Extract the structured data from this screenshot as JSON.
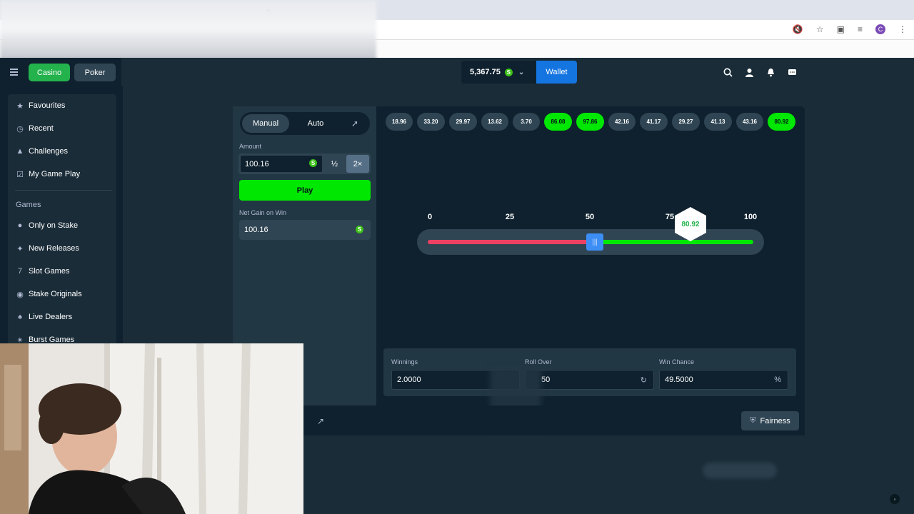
{
  "browser": {
    "new_tab": "+",
    "profile_initial": "C"
  },
  "topbar": {
    "casino_label": "Casino",
    "poker_label": "Poker",
    "balance": "5,367.75",
    "currency_symbol": "S",
    "wallet_label": "Wallet",
    "icons": [
      "search-icon",
      "user-icon",
      "notification-icon",
      "chat-icon"
    ]
  },
  "sidebar": {
    "items": [
      {
        "label": "Favourites",
        "icon": "star-icon"
      },
      {
        "label": "Recent",
        "icon": "clock-icon"
      },
      {
        "label": "Challenges",
        "icon": "challenge-icon"
      },
      {
        "label": "My Game Play",
        "icon": "checkbox-icon"
      }
    ],
    "games_heading": "Games",
    "games": [
      {
        "label": "Only on Stake",
        "icon": "stake-icon"
      },
      {
        "label": "New Releases",
        "icon": "sparkle-icon"
      },
      {
        "label": "Slot Games",
        "icon": "slot-icon"
      },
      {
        "label": "Stake Originals",
        "icon": "flame-icon"
      },
      {
        "label": "Live Dealers",
        "icon": "dealer-icon"
      },
      {
        "label": "Burst Games",
        "icon": "burst-icon"
      }
    ]
  },
  "controls": {
    "manual_label": "Manual",
    "auto_label": "Auto",
    "amount_label": "Amount",
    "amount_value": "100.16",
    "half_label": "½",
    "double_label": "2×",
    "play_label": "Play",
    "net_gain_label": "Net Gain on Win",
    "net_gain_value": "100.16"
  },
  "history": [
    {
      "value": "18.96",
      "win": false
    },
    {
      "value": "33.20",
      "win": false
    },
    {
      "value": "29.97",
      "win": false
    },
    {
      "value": "13.62",
      "win": false
    },
    {
      "value": "3.70",
      "win": false
    },
    {
      "value": "86.08",
      "win": true
    },
    {
      "value": "97.86",
      "win": true
    },
    {
      "value": "42.16",
      "win": false
    },
    {
      "value": "41.17",
      "win": false
    },
    {
      "value": "29.27",
      "win": false
    },
    {
      "value": "41.13",
      "win": false
    },
    {
      "value": "43.16",
      "win": false
    },
    {
      "value": "80.92",
      "win": true
    }
  ],
  "slider": {
    "ticks": [
      "0",
      "25",
      "50",
      "75",
      "100"
    ],
    "roll_over": 50,
    "result": "80.92",
    "colors": {
      "lose": "#ed4163",
      "win": "#00e701",
      "handle": "#3c8ef5"
    }
  },
  "stats": {
    "winnings_label": "Winnings",
    "winnings_value": "2.0000",
    "roll_over_label": "Roll Over",
    "roll_over_value": "50",
    "win_chance_label": "Win Chance",
    "win_chance_value": "49.5000",
    "win_chance_suffix": "%"
  },
  "footer": {
    "fairness_label": "Fairness"
  }
}
